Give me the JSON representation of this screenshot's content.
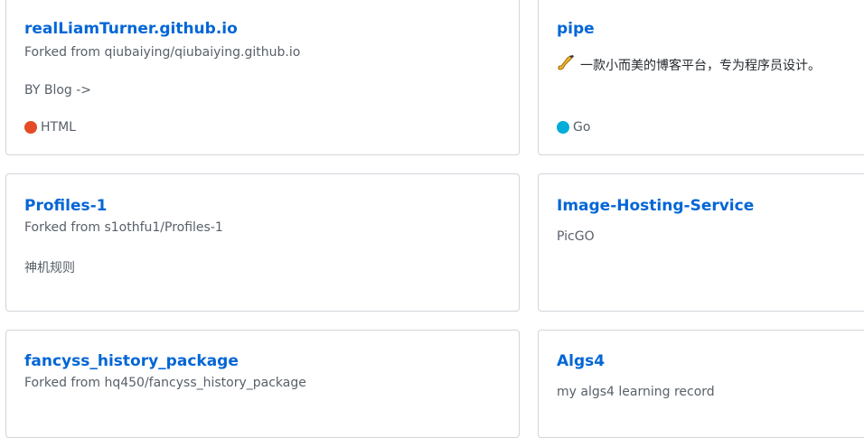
{
  "repos": [
    {
      "name": "realLiamTurner.github.io",
      "forked_from": "Forked from qiubaiying/qiubaiying.github.io",
      "description": "BY Blog ->",
      "language": "HTML",
      "language_color": "#e34c26"
    },
    {
      "name": "pipe",
      "description": "一款小而美的博客平台，专为程序员设计。",
      "description_icon": "saxophone-icon",
      "language": "Go",
      "language_color": "#00add8"
    },
    {
      "name": "Profiles-1",
      "forked_from": "Forked from s1othfu1/Profiles-1",
      "description": "神机规则"
    },
    {
      "name": "Image-Hosting-Service",
      "description": "PicGO"
    },
    {
      "name": "fancyss_history_package",
      "forked_from": "Forked from hq450/fancyss_history_package"
    },
    {
      "name": "Algs4",
      "description": "my algs4 learning record"
    }
  ],
  "colors": {
    "link": "#0366d6",
    "muted": "#586069",
    "border": "#d1d5da"
  }
}
